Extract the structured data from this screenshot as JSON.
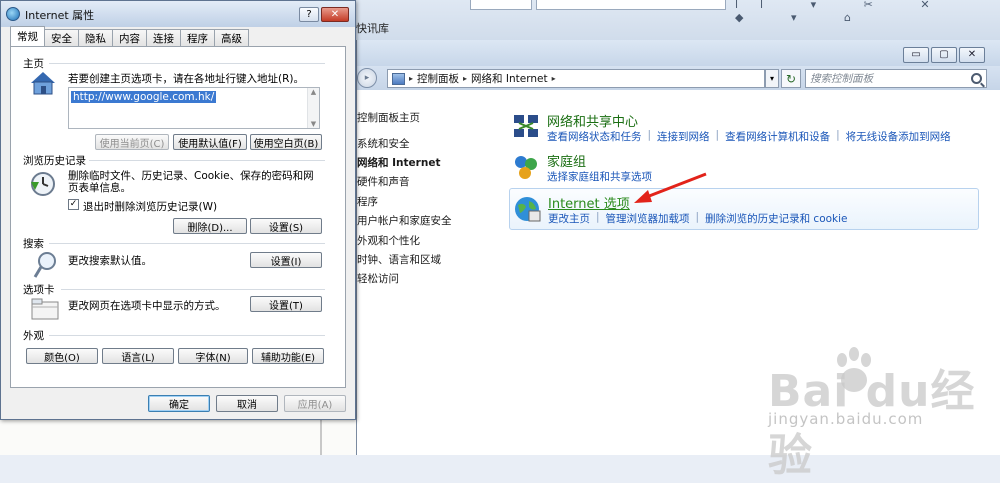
{
  "background": {
    "top_news_text": "快讯库",
    "top_glyphs": "ll ▾ ✂ ✕ ◆ ▾ ⌂"
  },
  "control_panel": {
    "window_buttons": {
      "minimize": "▭",
      "maximize": "▢",
      "close": "✕"
    },
    "breadcrumb": [
      "控制面板",
      "网络和 Internet"
    ],
    "search_placeholder": "搜索控制面板",
    "sidebar": [
      {
        "label": "控制面板主页",
        "bold": false
      },
      {
        "label": "系统和安全",
        "bold": false
      },
      {
        "label": "网络和 Internet",
        "bold": true
      },
      {
        "label": "硬件和声音",
        "bold": false
      },
      {
        "label": "程序",
        "bold": false
      },
      {
        "label": "用户帐户和家庭安全",
        "bold": false
      },
      {
        "label": "外观和个性化",
        "bold": false
      },
      {
        "label": "时钟、语言和区域",
        "bold": false
      },
      {
        "label": "轻松访问",
        "bold": false
      }
    ],
    "categories": [
      {
        "icon": "network-center-icon",
        "title": "网络和共享中心",
        "links": [
          "查看网络状态和任务",
          "连接到网络",
          "查看网络计算机和设备",
          "将无线设备添加到网络"
        ]
      },
      {
        "icon": "homegroup-icon",
        "title": "家庭组",
        "links": [
          "选择家庭组和共享选项"
        ]
      },
      {
        "icon": "internet-options-icon",
        "title": "Internet 选项",
        "links": [
          "更改主页",
          "管理浏览器加载项",
          "删除浏览的历史记录和 cookie"
        ],
        "highlighted": true
      }
    ]
  },
  "watermark": {
    "logo_text": "Bai  du经验",
    "url": "jingyan.baidu.com"
  },
  "dialog": {
    "title": "Internet 属性",
    "help": "?",
    "close": "✕",
    "tabs": [
      "常规",
      "安全",
      "隐私",
      "内容",
      "连接",
      "程序",
      "高级"
    ],
    "active_tab": 0,
    "homepage": {
      "group": "主页",
      "instruction": "若要创建主页选项卡，请在各地址行键入地址(R)。",
      "url": "http://www.google.com.hk/",
      "buttons": [
        "使用当前页(C)",
        "使用默认值(F)",
        "使用空白页(B)"
      ]
    },
    "history": {
      "group": "浏览历史记录",
      "description": "删除临时文件、历史记录、Cookie、保存的密码和网页表单信息。",
      "checkbox_label": "退出时删除浏览历史记录(W)",
      "checkbox_checked": true,
      "checkbox_mark": "✓",
      "buttons": [
        "删除(D)...",
        "设置(S)"
      ]
    },
    "search": {
      "group": "搜索",
      "description": "更改搜索默认值。",
      "button": "设置(I)"
    },
    "tabs_section": {
      "group": "选项卡",
      "description": "更改网页在选项卡中显示的方式。",
      "button": "设置(T)"
    },
    "appearance": {
      "group": "外观",
      "buttons": [
        "颜色(O)",
        "语言(L)",
        "字体(N)",
        "辅助功能(E)"
      ]
    },
    "footer": {
      "ok": "确定",
      "cancel": "取消",
      "apply": "应用(A)"
    }
  }
}
